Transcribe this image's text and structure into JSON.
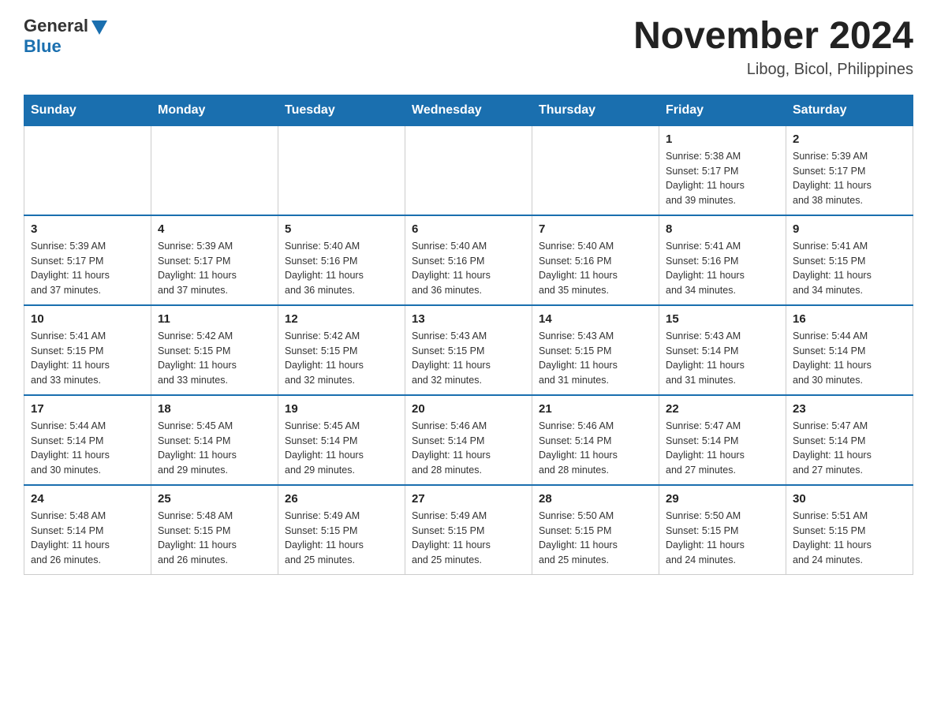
{
  "header": {
    "logo_text_general": "General",
    "logo_text_blue": "Blue",
    "calendar_title": "November 2024",
    "calendar_subtitle": "Libog, Bicol, Philippines"
  },
  "days_of_week": [
    "Sunday",
    "Monday",
    "Tuesday",
    "Wednesday",
    "Thursday",
    "Friday",
    "Saturday"
  ],
  "weeks": [
    [
      {
        "day": "",
        "info": ""
      },
      {
        "day": "",
        "info": ""
      },
      {
        "day": "",
        "info": ""
      },
      {
        "day": "",
        "info": ""
      },
      {
        "day": "",
        "info": ""
      },
      {
        "day": "1",
        "info": "Sunrise: 5:38 AM\nSunset: 5:17 PM\nDaylight: 11 hours\nand 39 minutes."
      },
      {
        "day": "2",
        "info": "Sunrise: 5:39 AM\nSunset: 5:17 PM\nDaylight: 11 hours\nand 38 minutes."
      }
    ],
    [
      {
        "day": "3",
        "info": "Sunrise: 5:39 AM\nSunset: 5:17 PM\nDaylight: 11 hours\nand 37 minutes."
      },
      {
        "day": "4",
        "info": "Sunrise: 5:39 AM\nSunset: 5:17 PM\nDaylight: 11 hours\nand 37 minutes."
      },
      {
        "day": "5",
        "info": "Sunrise: 5:40 AM\nSunset: 5:16 PM\nDaylight: 11 hours\nand 36 minutes."
      },
      {
        "day": "6",
        "info": "Sunrise: 5:40 AM\nSunset: 5:16 PM\nDaylight: 11 hours\nand 36 minutes."
      },
      {
        "day": "7",
        "info": "Sunrise: 5:40 AM\nSunset: 5:16 PM\nDaylight: 11 hours\nand 35 minutes."
      },
      {
        "day": "8",
        "info": "Sunrise: 5:41 AM\nSunset: 5:16 PM\nDaylight: 11 hours\nand 34 minutes."
      },
      {
        "day": "9",
        "info": "Sunrise: 5:41 AM\nSunset: 5:15 PM\nDaylight: 11 hours\nand 34 minutes."
      }
    ],
    [
      {
        "day": "10",
        "info": "Sunrise: 5:41 AM\nSunset: 5:15 PM\nDaylight: 11 hours\nand 33 minutes."
      },
      {
        "day": "11",
        "info": "Sunrise: 5:42 AM\nSunset: 5:15 PM\nDaylight: 11 hours\nand 33 minutes."
      },
      {
        "day": "12",
        "info": "Sunrise: 5:42 AM\nSunset: 5:15 PM\nDaylight: 11 hours\nand 32 minutes."
      },
      {
        "day": "13",
        "info": "Sunrise: 5:43 AM\nSunset: 5:15 PM\nDaylight: 11 hours\nand 32 minutes."
      },
      {
        "day": "14",
        "info": "Sunrise: 5:43 AM\nSunset: 5:15 PM\nDaylight: 11 hours\nand 31 minutes."
      },
      {
        "day": "15",
        "info": "Sunrise: 5:43 AM\nSunset: 5:14 PM\nDaylight: 11 hours\nand 31 minutes."
      },
      {
        "day": "16",
        "info": "Sunrise: 5:44 AM\nSunset: 5:14 PM\nDaylight: 11 hours\nand 30 minutes."
      }
    ],
    [
      {
        "day": "17",
        "info": "Sunrise: 5:44 AM\nSunset: 5:14 PM\nDaylight: 11 hours\nand 30 minutes."
      },
      {
        "day": "18",
        "info": "Sunrise: 5:45 AM\nSunset: 5:14 PM\nDaylight: 11 hours\nand 29 minutes."
      },
      {
        "day": "19",
        "info": "Sunrise: 5:45 AM\nSunset: 5:14 PM\nDaylight: 11 hours\nand 29 minutes."
      },
      {
        "day": "20",
        "info": "Sunrise: 5:46 AM\nSunset: 5:14 PM\nDaylight: 11 hours\nand 28 minutes."
      },
      {
        "day": "21",
        "info": "Sunrise: 5:46 AM\nSunset: 5:14 PM\nDaylight: 11 hours\nand 28 minutes."
      },
      {
        "day": "22",
        "info": "Sunrise: 5:47 AM\nSunset: 5:14 PM\nDaylight: 11 hours\nand 27 minutes."
      },
      {
        "day": "23",
        "info": "Sunrise: 5:47 AM\nSunset: 5:14 PM\nDaylight: 11 hours\nand 27 minutes."
      }
    ],
    [
      {
        "day": "24",
        "info": "Sunrise: 5:48 AM\nSunset: 5:14 PM\nDaylight: 11 hours\nand 26 minutes."
      },
      {
        "day": "25",
        "info": "Sunrise: 5:48 AM\nSunset: 5:15 PM\nDaylight: 11 hours\nand 26 minutes."
      },
      {
        "day": "26",
        "info": "Sunrise: 5:49 AM\nSunset: 5:15 PM\nDaylight: 11 hours\nand 25 minutes."
      },
      {
        "day": "27",
        "info": "Sunrise: 5:49 AM\nSunset: 5:15 PM\nDaylight: 11 hours\nand 25 minutes."
      },
      {
        "day": "28",
        "info": "Sunrise: 5:50 AM\nSunset: 5:15 PM\nDaylight: 11 hours\nand 25 minutes."
      },
      {
        "day": "29",
        "info": "Sunrise: 5:50 AM\nSunset: 5:15 PM\nDaylight: 11 hours\nand 24 minutes."
      },
      {
        "day": "30",
        "info": "Sunrise: 5:51 AM\nSunset: 5:15 PM\nDaylight: 11 hours\nand 24 minutes."
      }
    ]
  ]
}
